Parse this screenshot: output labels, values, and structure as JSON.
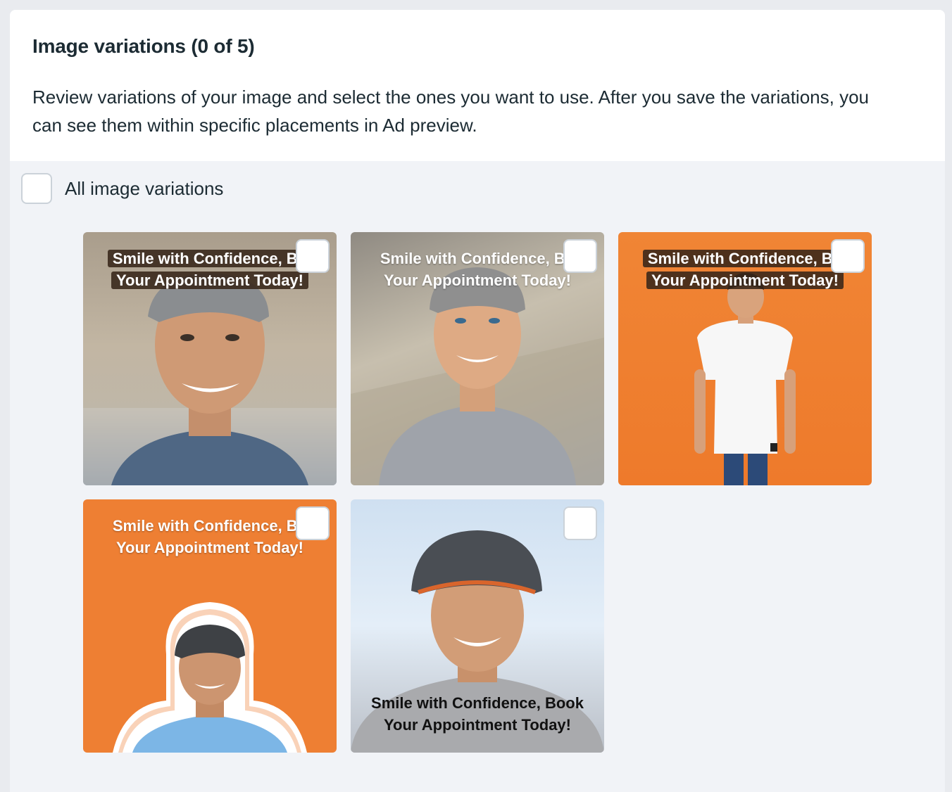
{
  "header": {
    "title": "Image variations (0 of 5)",
    "description": "Review variations of your image and select the ones you want to use. After you save the variations, you can see them within specific placements in Ad preview."
  },
  "select_all": {
    "label": "All image variations",
    "checked": false
  },
  "variations": [
    {
      "caption_line1": "Smile with Confidence, Bo",
      "caption_line2": "Your Appointment Today!",
      "checked": false,
      "caption_style": "dark-box"
    },
    {
      "caption_line1": "Smile with Confidence, Bo",
      "caption_line2": "Your Appointment Today!",
      "checked": false,
      "caption_style": "plain-white"
    },
    {
      "caption_line1": "Smile with Confidence, Bo",
      "caption_line2": "Your Appointment Today!",
      "checked": false,
      "caption_style": "dark-box"
    },
    {
      "caption_line1": "Smile with Confidence, Bo",
      "caption_line2": "Your Appointment Today!",
      "checked": false,
      "caption_style": "plain-white"
    },
    {
      "caption_line1": "Smile with Confidence, Book",
      "caption_line2": "Your Appointment Today!",
      "checked": false,
      "caption_style": "plain-black"
    }
  ],
  "colors": {
    "accent_orange": "#ee7f33",
    "panel_bg": "#f1f3f7",
    "text": "#1c2b33"
  }
}
